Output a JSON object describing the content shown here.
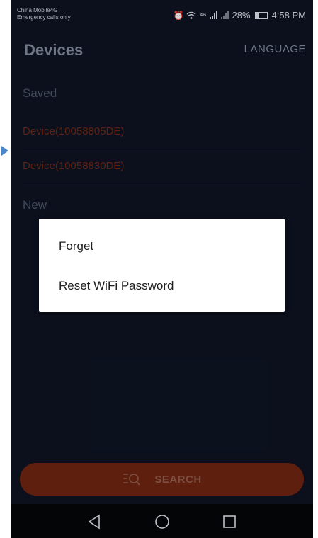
{
  "status_bar": {
    "carrier_line1": "China Mobile4G",
    "carrier_line2": "Emergency calls only",
    "network": "⁴⁶",
    "battery": "28%",
    "time": "4:58 PM"
  },
  "header": {
    "title": "Devices",
    "language_label": "LANGUAGE"
  },
  "saved_section": {
    "label": "Saved",
    "devices": [
      "Device(10058805DE)",
      "Device(10058830DE)"
    ]
  },
  "new_section": {
    "label": "New"
  },
  "dialog": {
    "items": [
      "Forget",
      "Reset WiFi Password"
    ]
  },
  "search_button": {
    "label": "SEARCH"
  },
  "colors": {
    "background": "#0e1322",
    "accent": "#6c2412",
    "device_text": "#6a2716",
    "dialog_bg": "#ffffff"
  }
}
